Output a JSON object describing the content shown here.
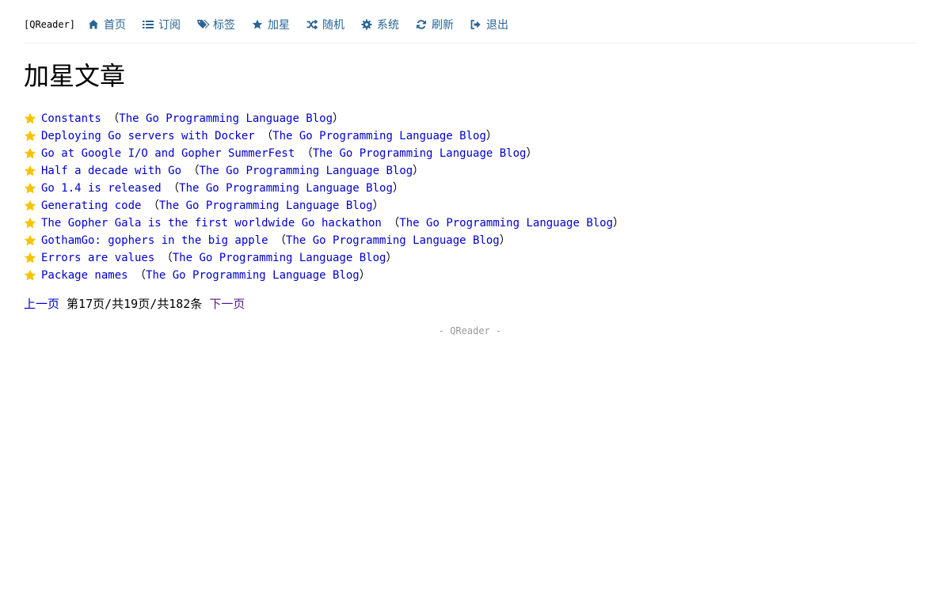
{
  "nav": {
    "brand": "[QReader]",
    "items": [
      {
        "label": "首页",
        "icon": "home-icon"
      },
      {
        "label": "订阅",
        "icon": "list-icon"
      },
      {
        "label": "标签",
        "icon": "tags-icon"
      },
      {
        "label": "加星",
        "icon": "star-icon"
      },
      {
        "label": "随机",
        "icon": "random-icon"
      },
      {
        "label": "系统",
        "icon": "gear-icon"
      },
      {
        "label": "刷新",
        "icon": "refresh-icon"
      },
      {
        "label": "退出",
        "icon": "sign-out-icon"
      }
    ],
    "color": "#2a6496"
  },
  "page": {
    "title": "加星文章"
  },
  "articles": [
    {
      "title": "Constants",
      "source": "The Go Programming Language Blog"
    },
    {
      "title": "Deploying Go servers with Docker",
      "source": "The Go Programming Language Blog"
    },
    {
      "title": "Go at Google I/O and Gopher SummerFest",
      "source": "The Go Programming Language Blog"
    },
    {
      "title": "Half a decade with Go",
      "source": "The Go Programming Language Blog"
    },
    {
      "title": "Go 1.4 is released",
      "source": "The Go Programming Language Blog"
    },
    {
      "title": "Generating code",
      "source": "The Go Programming Language Blog"
    },
    {
      "title": "The Gopher Gala is the first worldwide Go hackathon",
      "source": "The Go Programming Language Blog"
    },
    {
      "title": "GothamGo: gophers in the big apple",
      "source": "The Go Programming Language Blog"
    },
    {
      "title": "Errors are values",
      "source": "The Go Programming Language Blog"
    },
    {
      "title": "Package names",
      "source": "The Go Programming Language Blog"
    }
  ],
  "pager": {
    "prev_label": "上一页",
    "status": "第17页/共19页/共182条",
    "next_label": "下一页"
  },
  "footer": {
    "text": "- QReader -"
  },
  "colors": {
    "link": "#0000cc",
    "visited": "#551a8b",
    "star": "#f5c400"
  }
}
